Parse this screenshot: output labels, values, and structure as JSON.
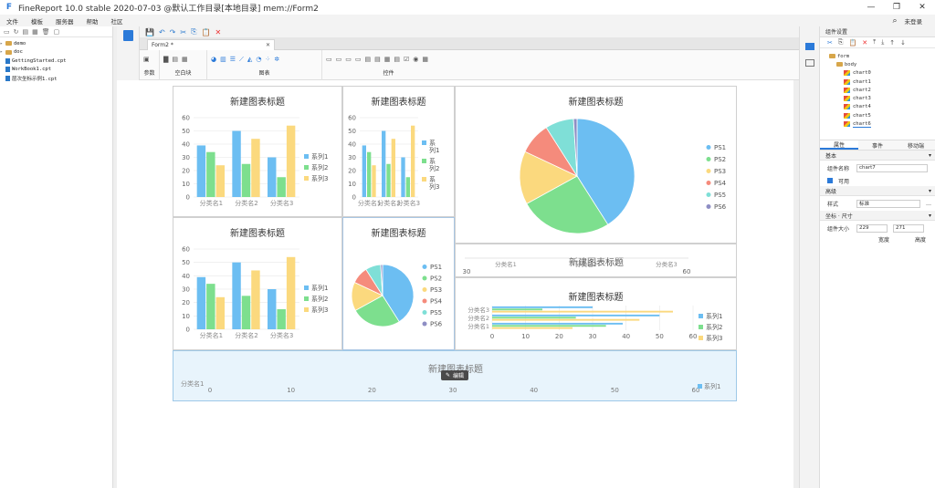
{
  "app": {
    "title": "FineReport 10.0 stable 2020-07-03 @默认工作目录[本地目录]    mem://Form2",
    "logo": "F"
  },
  "menu": {
    "items": [
      "文件",
      "模板",
      "服务器",
      "帮助",
      "社区"
    ],
    "login": "未登录"
  },
  "file_tree": {
    "items": [
      {
        "type": "folder",
        "label": "demo"
      },
      {
        "type": "folder",
        "label": "doc"
      },
      {
        "type": "file",
        "label": "GettingStarted.cpt"
      },
      {
        "type": "file",
        "label": "WorkBook1.cpt"
      },
      {
        "type": "file",
        "label": "层次坐标示例1.cpt"
      }
    ]
  },
  "editor": {
    "tab_label": "Form2 *"
  },
  "ribbon": {
    "groups": [
      "参数",
      "空白块",
      "图表",
      "控件"
    ]
  },
  "charts_common": {
    "title": "新建图表标题",
    "categories": [
      "分类名1",
      "分类名2",
      "分类名3"
    ],
    "series_names": [
      "系列1",
      "系列2",
      "系列3"
    ],
    "pie_names": [
      "PS1",
      "PS2",
      "PS3",
      "PS4",
      "PS5",
      "PS6"
    ]
  },
  "chart_data": [
    {
      "type": "bar",
      "title": "新建图表标题",
      "categories": [
        "分类名1",
        "分类名2",
        "分类名3"
      ],
      "ylim": [
        0,
        60
      ],
      "series": [
        {
          "name": "系列1",
          "values": [
            39,
            50,
            30
          ]
        },
        {
          "name": "系列2",
          "values": [
            34,
            25,
            15
          ]
        },
        {
          "name": "系列3",
          "values": [
            24,
            44,
            54
          ]
        }
      ]
    },
    {
      "type": "bar",
      "title": "新建图表标题",
      "categories": [
        "分类名1",
        "分类名2",
        "分类名3"
      ],
      "ylim": [
        0,
        60
      ],
      "series": [
        {
          "name": "系列1",
          "values": [
            39,
            50,
            30
          ]
        },
        {
          "name": "系列2",
          "values": [
            34,
            25,
            15
          ]
        },
        {
          "name": "系列3",
          "values": [
            24,
            44,
            54
          ]
        }
      ]
    },
    {
      "type": "pie",
      "title": "新建图表标题",
      "labels": [
        "PS1",
        "PS2",
        "PS3",
        "PS4",
        "PS5",
        "PS6"
      ],
      "values": [
        41,
        26,
        15,
        9,
        8,
        1
      ]
    },
    {
      "type": "bar",
      "title": "新建图表标题",
      "categories": [
        "分类名1",
        "分类名2",
        "分类名3"
      ],
      "ylim": [
        0,
        60
      ],
      "series": [
        {
          "name": "系列1",
          "values": [
            39,
            50,
            30
          ]
        },
        {
          "name": "系列2",
          "values": [
            34,
            25,
            15
          ]
        },
        {
          "name": "系列3",
          "values": [
            24,
            44,
            54
          ]
        }
      ]
    },
    {
      "type": "pie",
      "title": "新建图表标题",
      "labels": [
        "PS1",
        "PS2",
        "PS3",
        "PS4",
        "PS5",
        "PS6"
      ],
      "values": [
        41,
        26,
        15,
        9,
        8,
        1
      ]
    },
    {
      "type": "bar",
      "orientation": "horizontal",
      "title": "新建图表标题",
      "categories": [
        "分类名1",
        "分类名2",
        "分类名3"
      ],
      "xlim": [
        30,
        60
      ],
      "xticks": [
        30,
        60
      ]
    },
    {
      "type": "bar",
      "orientation": "horizontal",
      "title": "新建图表标题",
      "categories": [
        "分类名1",
        "分类名2",
        "分类名3"
      ],
      "xlim": [
        0,
        60
      ],
      "series": [
        {
          "name": "系列1",
          "values": [
            39,
            50,
            30
          ]
        },
        {
          "name": "系列2",
          "values": [
            34,
            25,
            15
          ]
        },
        {
          "name": "系列3",
          "values": [
            24,
            44,
            54
          ]
        }
      ]
    },
    {
      "type": "bar",
      "orientation": "horizontal",
      "title": "新建图表标题",
      "categories": [
        "分类名1"
      ],
      "xlim": [
        0,
        60
      ],
      "series": [
        {
          "name": "系列1",
          "values": []
        }
      ]
    }
  ],
  "colors": {
    "s1": "#6cbef2",
    "s2": "#7ddf8e",
    "s3": "#fbd97e",
    "pie": [
      "#6cbef2",
      "#7ddf8e",
      "#fbd97e",
      "#f58b7c",
      "#7fdfd7",
      "#8e8ec4"
    ]
  },
  "edit_badge": "编辑",
  "right_panel": {
    "header": "组件设置",
    "tree": [
      {
        "label": "form",
        "level": 0
      },
      {
        "label": "body",
        "level": 1
      },
      {
        "label": "chart0",
        "level": 2
      },
      {
        "label": "chart1",
        "level": 2
      },
      {
        "label": "chart2",
        "level": 2
      },
      {
        "label": "chart3",
        "level": 2
      },
      {
        "label": "chart4",
        "level": 2
      },
      {
        "label": "chart5",
        "level": 2
      },
      {
        "label": "chart6",
        "level": 2
      }
    ],
    "tabs": [
      "属性",
      "事件",
      "移动端"
    ],
    "sections": {
      "basic": "基本",
      "advanced": "高级",
      "coords": "坐标 · 尺寸"
    },
    "fields": {
      "name_label": "组件名称",
      "name_value": "chart7",
      "visible_label": "可用",
      "style_label": "样式",
      "style_value": "标准",
      "size_label": "组件大小",
      "width_value": "229",
      "height_value": "271",
      "width_label": "宽度",
      "height_label": "高度"
    }
  }
}
